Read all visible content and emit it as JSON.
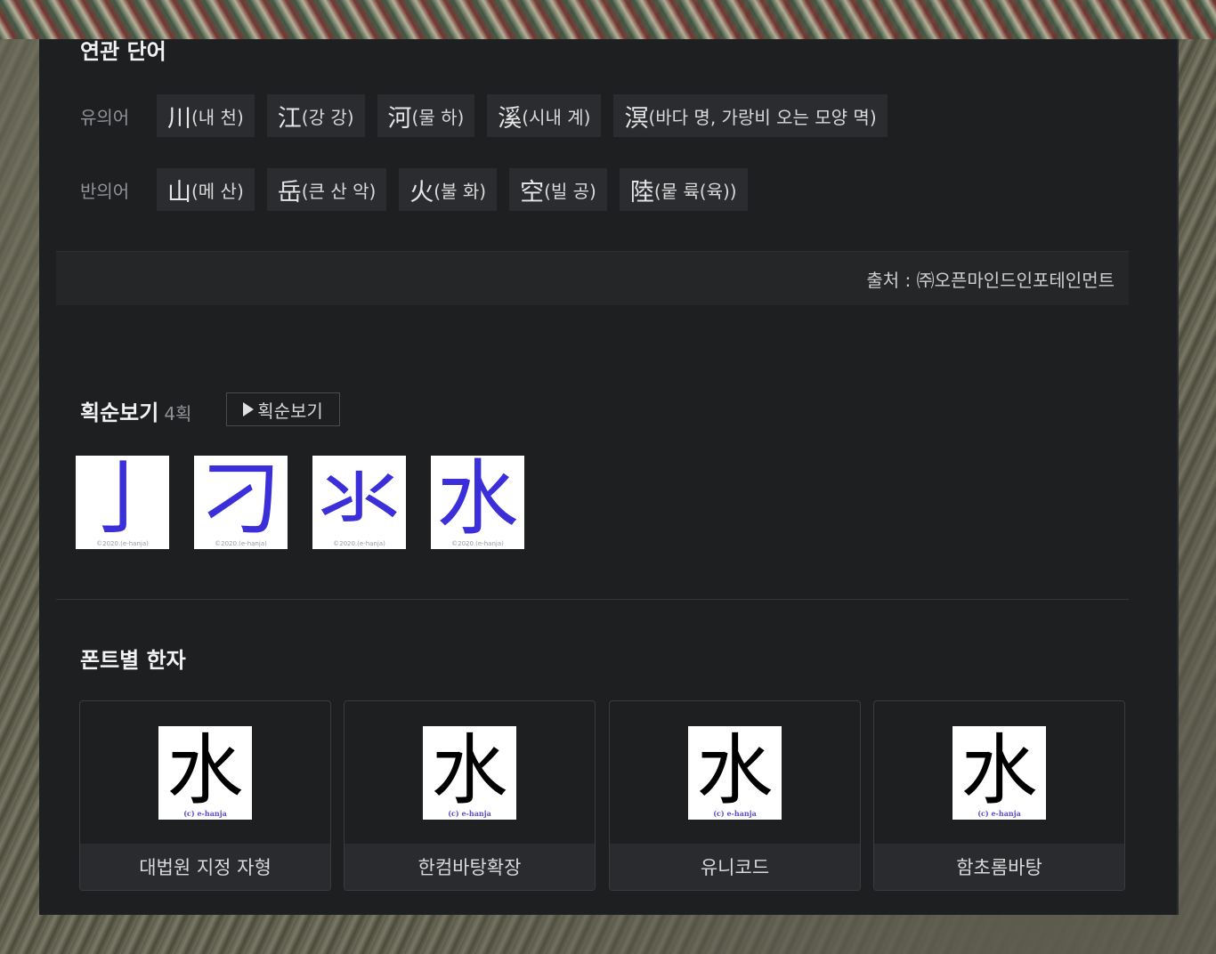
{
  "related": {
    "title": "연관 단어",
    "synonyms_label": "유의어",
    "synonyms": [
      {
        "han": "川",
        "reading": "(내 천)"
      },
      {
        "han": "江",
        "reading": "(강 강)"
      },
      {
        "han": "河",
        "reading": "(물 하)"
      },
      {
        "han": "溪",
        "reading": "(시내 계)"
      },
      {
        "han": "溟",
        "reading": "(바다 명, 가랑비 오는 모양 멱)"
      }
    ],
    "antonyms_label": "반의어",
    "antonyms": [
      {
        "han": "山",
        "reading": "(메 산)"
      },
      {
        "han": "岳",
        "reading": "(큰 산 악)"
      },
      {
        "han": "火",
        "reading": "(불 화)"
      },
      {
        "han": "空",
        "reading": "(빌 공)"
      },
      {
        "han": "陸",
        "reading": "(뭍 륙(육))"
      }
    ],
    "source": "출처 : ㈜오픈마인드인포테인먼트"
  },
  "stroke_order": {
    "title": "획순보기",
    "count": "4획",
    "button_label": "획순보기",
    "steps": [
      "亅",
      "刁",
      "氺",
      "水"
    ],
    "copyright": "©2020.(e-hanja)"
  },
  "fonts": {
    "title": "폰트별 한자",
    "glyph": "水",
    "copyright": "(c) e-hanja",
    "items": [
      "대법원 지정 자형",
      "한컴바탕확장",
      "유니코드",
      "함초롬바탕"
    ]
  }
}
